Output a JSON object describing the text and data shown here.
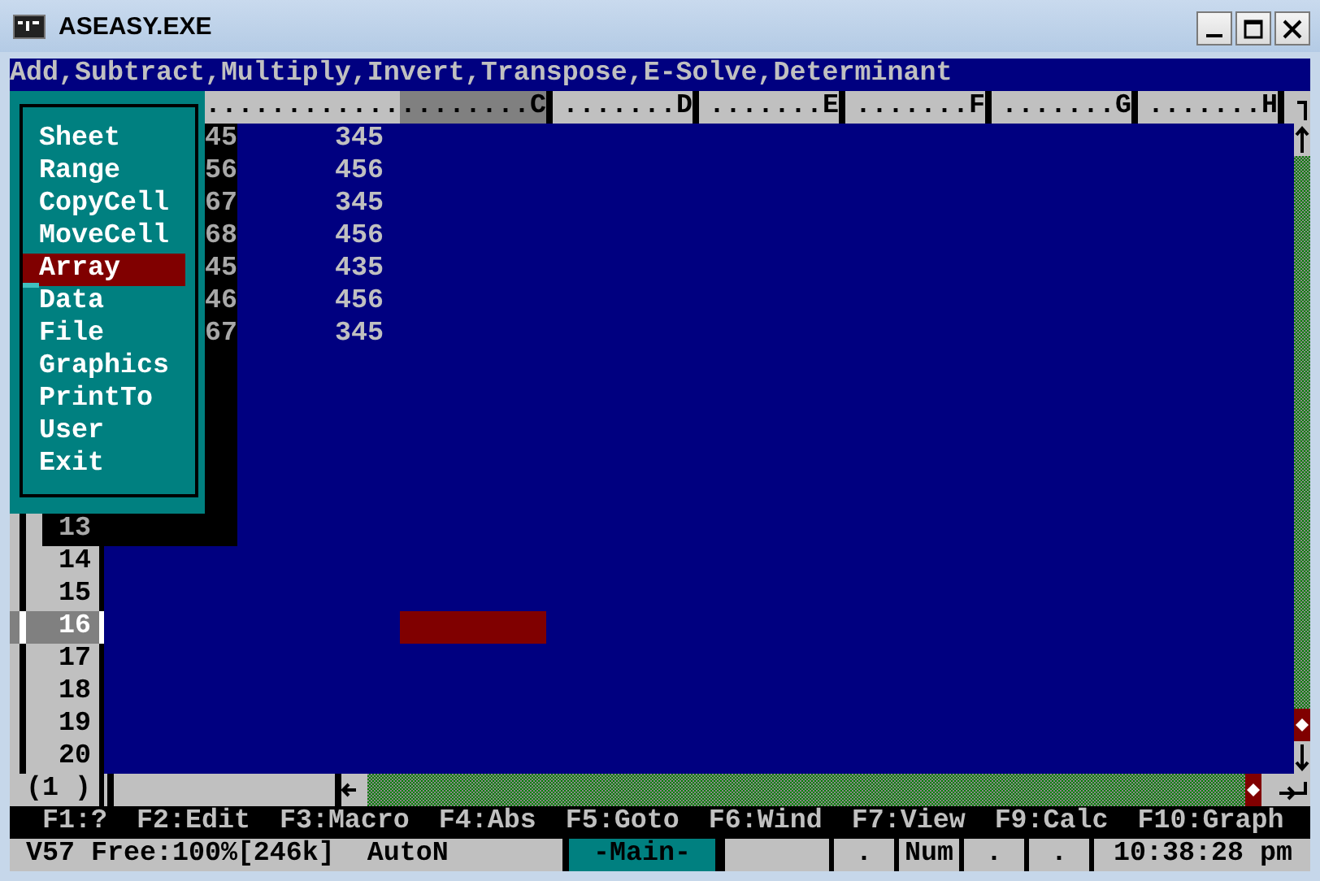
{
  "window": {
    "title": "ASEASY.EXE"
  },
  "prompt": "Add,Subtract,Multiply,Invert,Transpose,E-Solve,Determinant",
  "menu": {
    "items": [
      {
        "label": "Sheet",
        "selected": false
      },
      {
        "label": "Range",
        "selected": false
      },
      {
        "label": "CopyCell",
        "selected": false
      },
      {
        "label": "MoveCell",
        "selected": false
      },
      {
        "label": "Array",
        "selected": true
      },
      {
        "label": "Data",
        "selected": false
      },
      {
        "label": "File",
        "selected": false
      },
      {
        "label": "Graphics",
        "selected": false
      },
      {
        "label": "PrintTo",
        "selected": false
      },
      {
        "label": "User",
        "selected": false
      },
      {
        "label": "Exit",
        "selected": false
      }
    ]
  },
  "grid": {
    "header_lead": "............",
    "columns": [
      {
        "label": "........C",
        "selected": true
      },
      {
        "label": ".......D",
        "selected": false
      },
      {
        "label": ".......E",
        "selected": false
      },
      {
        "label": ".......F",
        "selected": false
      },
      {
        "label": ".......G",
        "selected": false
      },
      {
        "label": ".......H",
        "selected": false
      }
    ],
    "row_numbers": [
      {
        "label": "13",
        "selected": false
      },
      {
        "label": "14",
        "selected": false
      },
      {
        "label": "15",
        "selected": false
      },
      {
        "label": "16",
        "selected": true
      },
      {
        "label": "17",
        "selected": false
      },
      {
        "label": "18",
        "selected": false
      },
      {
        "label": "19",
        "selected": false
      },
      {
        "label": "20",
        "selected": false
      }
    ],
    "rows": [
      {
        "column_a": "45",
        "column_b": "345"
      },
      {
        "column_a": "56",
        "column_b": "456"
      },
      {
        "column_a": "67",
        "column_b": "345"
      },
      {
        "column_a": "68",
        "column_b": "456"
      },
      {
        "column_a": "45",
        "column_b": "435"
      },
      {
        "column_a": "46",
        "column_b": "456"
      },
      {
        "column_a": "67",
        "column_b": "345"
      }
    ],
    "window_number": "(1 )"
  },
  "function_keys": [
    "F1:?",
    "F2:Edit",
    "F3:Macro",
    "F4:Abs",
    "F5:Goto",
    "F6:Wind",
    "F7:View",
    "F9:Calc",
    "F10:Graph"
  ],
  "status_bar": {
    "cell": "V57 Free:100%[246k]",
    "recalc": "AutoN",
    "menu_level": "-Main-",
    "indicators": [
      ".",
      "Num",
      ".",
      "."
    ],
    "clock": "10:38:28 pm"
  }
}
